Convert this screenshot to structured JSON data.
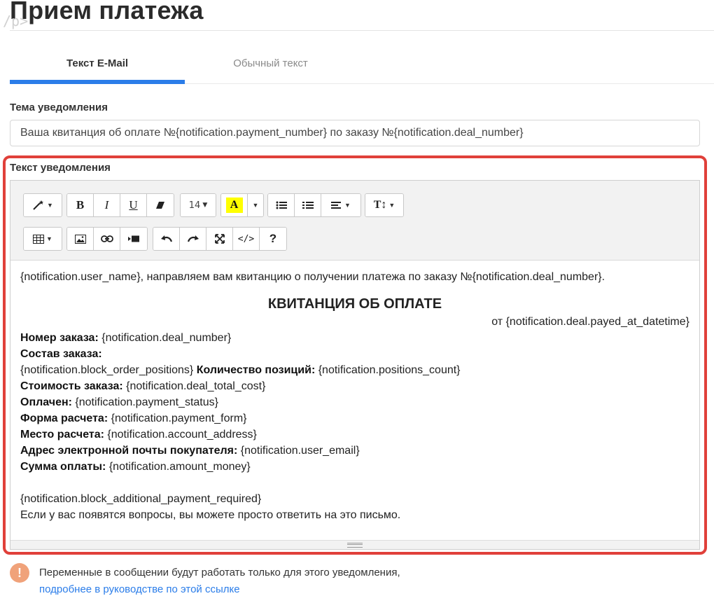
{
  "page": {
    "title": "Прием платежа",
    "ghost_text": "/p>"
  },
  "tabs": [
    {
      "label": "Текст E-Mail",
      "active": true
    },
    {
      "label": "Обычный текст",
      "active": false
    }
  ],
  "subject": {
    "label": "Тема уведомления",
    "value": "Ваша квитанция об оплате №{notification.payment_number} по заказу №{notification.deal_number}"
  },
  "editor": {
    "label": "Текст уведомления",
    "toolbar": {
      "font_size": "14",
      "color_letter": "A",
      "highlight_color": "#ffff00",
      "row1": [
        "magic-wand-icon",
        "bold-icon",
        "italic-icon",
        "underline-icon",
        "eraser-icon",
        "font-size",
        "text-color",
        "color-dropdown",
        "unordered-list-icon",
        "ordered-list-icon",
        "align-icon",
        "line-height-icon"
      ],
      "row2": [
        "table-icon",
        "image-icon",
        "link-icon",
        "video-icon",
        "undo-icon",
        "redo-icon",
        "fullscreen-icon",
        "code-view-icon",
        "help-icon"
      ]
    },
    "content": {
      "greeting": "{notification.user_name}, направляем вам квитанцию о получении платежа по заказу №{notification.deal_number}.",
      "receipt_title": "КВИТАНЦИЯ ОБ ОПЛАТЕ",
      "receipt_date": "от {notification.deal.payed_at_datetime}",
      "order_number_label": "Номер заказа:",
      "order_number_value": " {notification.deal_number}",
      "order_composition_label": "Состав заказа:",
      "order_positions_value": "{notification.block_order_positions} ",
      "positions_count_label": "Количество позиций:",
      "positions_count_value": " {notification.positions_count}",
      "order_cost_label": "Стоимость заказа:",
      "order_cost_value": " {notification.deal_total_cost}",
      "paid_label": "Оплачен:",
      "paid_value": " {notification.payment_status}",
      "payment_form_label": "Форма расчета:",
      "payment_form_value": " {notification.payment_form}",
      "payment_place_label": "Место расчета:",
      "payment_place_value": " {notification.account_address}",
      "email_label": "Адрес электронной почты покупателя:",
      "email_value": " {notification.user_email}",
      "amount_label": "Сумма оплаты:",
      "amount_value": " {notification.amount_money}",
      "additional_block": "{notification.block_additional_payment_required}",
      "closing": "Если у вас появятся вопросы, вы можете просто ответить на это письмо."
    }
  },
  "notice": {
    "icon": "!",
    "text": "Переменные в сообщении будут работать только для этого уведомления,",
    "link": "подробнее в руководстве по этой ссылке"
  },
  "colors": {
    "accent": "#2b7de9",
    "highlight_frame": "#e0403a",
    "notice_icon": "#f0a27a"
  }
}
